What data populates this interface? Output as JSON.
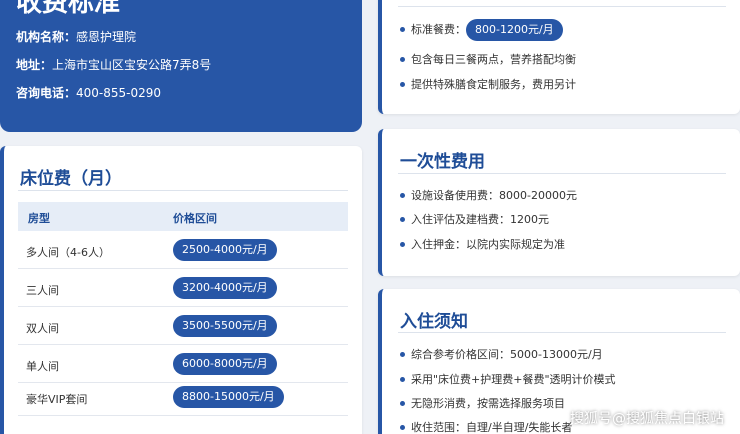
{
  "header": {
    "title": "收费标准",
    "org_label": "机构名称：",
    "org_value": "感恩护理院",
    "addr_label": "地址：",
    "addr_value": "上海市宝山区宝安公路7弄8号",
    "phone_label": "咨询电话：",
    "phone_value": "400-855-0290"
  },
  "bed_fee": {
    "title": "床位费（月）",
    "col_type": "房型",
    "col_price": "价格区间",
    "rows": [
      {
        "type": "多人间（4-6人）",
        "price": "2500-4000元/月"
      },
      {
        "type": "三人间",
        "price": "3200-4000元/月"
      },
      {
        "type": "双人间",
        "price": "3500-5500元/月"
      },
      {
        "type": "单人间",
        "price": "6000-8000元/月"
      },
      {
        "type": "豪华VIP套间",
        "price": "8800-15000元/月"
      }
    ]
  },
  "meal": {
    "items": [
      {
        "label": "标准餐费：",
        "pill": "800-1200元/月"
      },
      {
        "label": "包含每日三餐两点，营养搭配均衡"
      },
      {
        "label": "提供特殊膳食定制服务，费用另计"
      }
    ]
  },
  "one_time": {
    "title": "一次性费用",
    "items": [
      "设施设备使用费：8000-20000元",
      "入住评估及建档费：1200元",
      "入住押金：以院内实际规定为准"
    ]
  },
  "notice": {
    "title": "入住须知",
    "items": [
      "综合参考价格区间：5000-13000元/月",
      "采用\"床位费+护理费+餐费\"透明计价模式",
      "无隐形消费，按需选择服务项目",
      "收住范围：自理/半自理/失能长者"
    ]
  },
  "watermark": "搜狐号@搜狐焦点白银站",
  "colors": {
    "primary": "#2756a6",
    "title_blue": "#1f4d97",
    "background": "#eef1f6"
  }
}
